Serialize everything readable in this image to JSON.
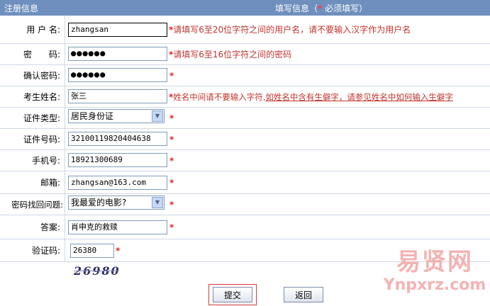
{
  "header": {
    "left": "注册信息",
    "right_prefix": "填写信息（",
    "right_star": "*",
    "right_suffix": " 必须填写）"
  },
  "fields": {
    "username": {
      "label": "用 户 名:",
      "value": "zhangsan",
      "hint_star": "*",
      "hint": "请填写6至20位字符之间的用户名，请不要输入汉字作为用户名"
    },
    "password": {
      "label": "密　　码:",
      "value": "●●●●●●",
      "hint_star": "*",
      "hint": "请填写6至16位字符之间的密码"
    },
    "confirm": {
      "label": "确认密码:",
      "value": "●●●●●●",
      "star": "*"
    },
    "name": {
      "label": "考生姓名:",
      "value": "张三",
      "hint_star": "*",
      "hint": "姓名中间请不要输入字符,",
      "hint_link": "如姓名中含有生僻字，请参见姓名中如何输入生僻字"
    },
    "id_type": {
      "label": "证件类型:",
      "value": "居民身份证",
      "star": "*"
    },
    "id_number": {
      "label": "证件号码:",
      "value": "32100119820404638",
      "star": "*"
    },
    "mobile": {
      "label": "手机号:",
      "value": "18921300689",
      "star": "*"
    },
    "email": {
      "label": "邮箱:",
      "value": "zhangsan@163.com",
      "star": "*"
    },
    "question": {
      "label": "密码找回问题:",
      "value": "我最爱的电影?",
      "star": "*"
    },
    "answer": {
      "label": "答案:",
      "value": "肖申克的救赎",
      "star": "*"
    },
    "captcha": {
      "label": "验证码:",
      "value": "26380",
      "star": "*",
      "image_text": "26980"
    }
  },
  "buttons": {
    "submit": "提交",
    "back": "返回"
  },
  "watermark": {
    "cn": "易贤网",
    "en": "Ynpxrz.com"
  }
}
